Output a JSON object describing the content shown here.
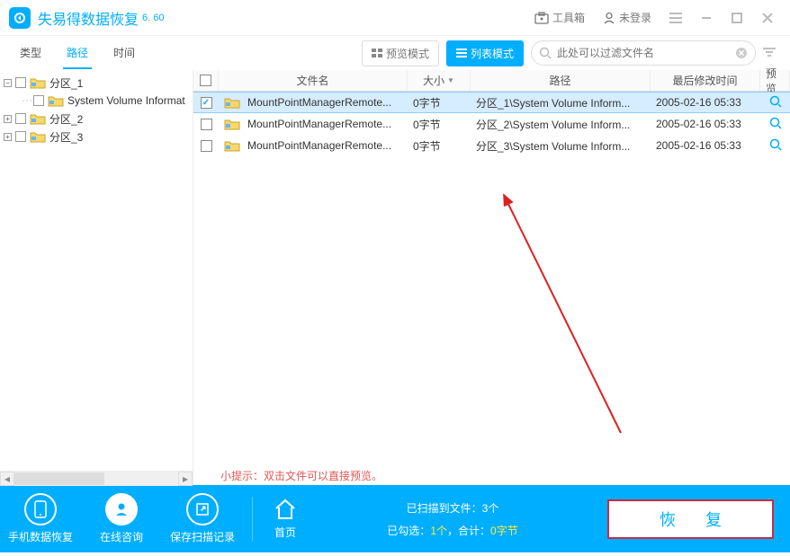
{
  "app": {
    "title": "失易得数据恢复",
    "version": "6. 60"
  },
  "titlebar": {
    "toolbox": "工具箱",
    "login": "未登录"
  },
  "tabs": {
    "type": "类型",
    "path": "路径",
    "time": "时间"
  },
  "modes": {
    "preview": "预览模式",
    "list": "列表模式"
  },
  "search": {
    "placeholder": "此处可以过滤文件名"
  },
  "tree": {
    "nodes": [
      {
        "label": "分区_1",
        "expanded": true,
        "indent": 0
      },
      {
        "label": "System Volume Informat",
        "indent": 1
      },
      {
        "label": "分区_2",
        "expanded": false,
        "indent": 0
      },
      {
        "label": "分区_3",
        "expanded": false,
        "indent": 0
      }
    ]
  },
  "columns": {
    "name": "文件名",
    "size": "大小",
    "path": "路径",
    "date": "最后修改时间",
    "preview": "预览"
  },
  "rows": [
    {
      "checked": true,
      "name": "MountPointManagerRemote...",
      "size": "0字节",
      "path": "分区_1\\System Volume Inform...",
      "date": "2005-02-16  05:33"
    },
    {
      "checked": false,
      "name": "MountPointManagerRemote...",
      "size": "0字节",
      "path": "分区_2\\System Volume Inform...",
      "date": "2005-02-16  05:33"
    },
    {
      "checked": false,
      "name": "MountPointManagerRemote...",
      "size": "0字节",
      "path": "分区_3\\System Volume Inform...",
      "date": "2005-02-16  05:33"
    }
  ],
  "hint": "小提示：双击文件可以直接预览。",
  "bottom": {
    "phone_recovery": "手机数据恢复",
    "online_consult": "在线咨询",
    "save_record": "保存扫描记录",
    "home": "首页",
    "scanned_label": "已扫描到文件：",
    "scanned_count": "3个",
    "selected_prefix": "已勾选：",
    "selected_count": "1个",
    "total_prefix": "，合计：",
    "total_size": "0字节",
    "recover": "恢  复"
  }
}
